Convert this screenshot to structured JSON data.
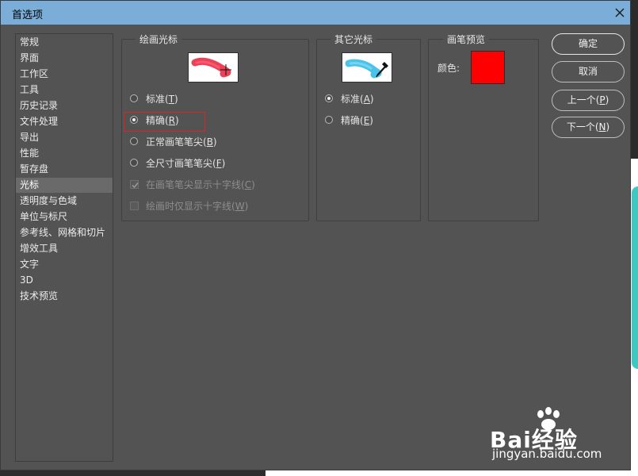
{
  "window": {
    "title": "首选项"
  },
  "sidebar": {
    "items": [
      {
        "label": "常规",
        "active": false
      },
      {
        "label": "界面",
        "active": false
      },
      {
        "label": "工作区",
        "active": false
      },
      {
        "label": "工具",
        "active": false
      },
      {
        "label": "历史记录",
        "active": false
      },
      {
        "label": "文件处理",
        "active": false
      },
      {
        "label": "导出",
        "active": false
      },
      {
        "label": "性能",
        "active": false
      },
      {
        "label": "暂存盘",
        "active": false
      },
      {
        "label": "光标",
        "active": true
      },
      {
        "label": "透明度与色域",
        "active": false
      },
      {
        "label": "单位与标尺",
        "active": false
      },
      {
        "label": "参考线、网格和切片",
        "active": false
      },
      {
        "label": "增效工具",
        "active": false
      },
      {
        "label": "文字",
        "active": false
      },
      {
        "label": "3D",
        "active": false
      },
      {
        "label": "技术预览",
        "active": false
      }
    ]
  },
  "painting_cursors": {
    "legend": "绘画光标",
    "preview_icon": "red-brush-stroke-with-crosshair",
    "options": [
      {
        "label": "标准(",
        "key": "T",
        "suffix": ")",
        "checked": false
      },
      {
        "label": "精确(",
        "key": "R",
        "suffix": ")",
        "checked": true
      },
      {
        "label": "正常画笔笔尖(",
        "key": "B",
        "suffix": ")",
        "checked": false
      },
      {
        "label": "全尺寸画笔笔尖(",
        "key": "F",
        "suffix": ")",
        "checked": false
      }
    ],
    "checkboxes": [
      {
        "label": "在画笔笔尖显示十字线(",
        "key": "C",
        "suffix": ")",
        "checked": true,
        "disabled": true
      },
      {
        "label": "绘画时仅显示十字线(",
        "key": "W",
        "suffix": ")",
        "checked": false,
        "disabled": true
      }
    ]
  },
  "other_cursors": {
    "legend": "其它光标",
    "preview_icon": "blue-brush-stroke-with-eyedropper",
    "options": [
      {
        "label": "标准(",
        "key": "A",
        "suffix": ")",
        "checked": true
      },
      {
        "label": "精确(",
        "key": "E",
        "suffix": ")",
        "checked": false
      }
    ]
  },
  "brush_preview": {
    "legend": "画笔预览",
    "color_label": "颜色:",
    "color": "#ff0000"
  },
  "buttons": {
    "ok": "确定",
    "cancel": "取消",
    "prev_label": "上一个(",
    "prev_key": "P",
    "prev_suffix": ")",
    "next_label": "下一个(",
    "next_key": "N",
    "next_suffix": ")"
  },
  "watermark": {
    "brand": "Bai经验",
    "url": "jingyan.baidu.com"
  },
  "colors": {
    "title_bar": "#7aaed8",
    "dialog_bg": "#535353",
    "highlight": "#d82525"
  }
}
